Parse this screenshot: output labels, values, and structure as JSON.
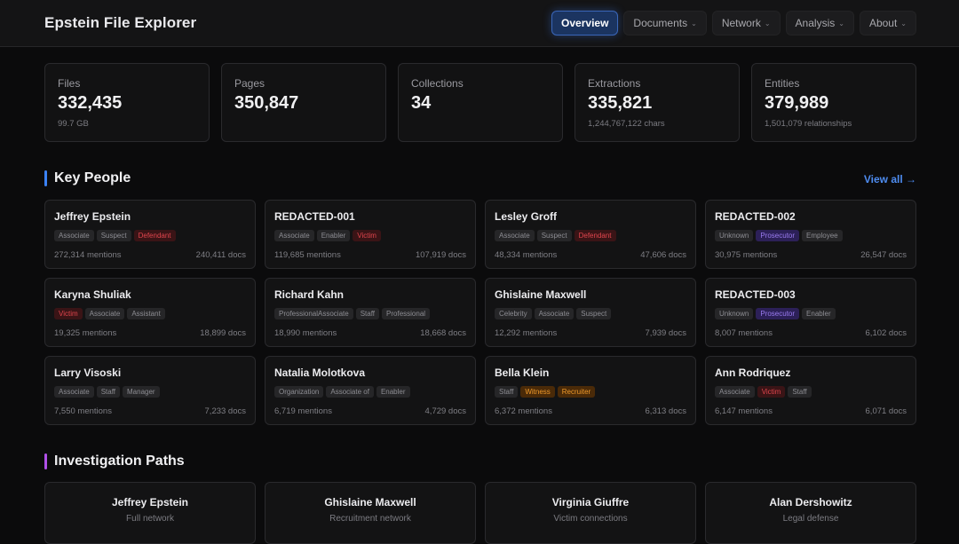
{
  "app": {
    "title": "Epstein File Explorer"
  },
  "nav": [
    {
      "label": "Overview",
      "active": true,
      "dropdown": false
    },
    {
      "label": "Documents",
      "active": false,
      "dropdown": true
    },
    {
      "label": "Network",
      "active": false,
      "dropdown": true
    },
    {
      "label": "Analysis",
      "active": false,
      "dropdown": true
    },
    {
      "label": "About",
      "active": false,
      "dropdown": true
    }
  ],
  "stats": [
    {
      "label": "Files",
      "value": "332,435",
      "sub": "99.7 GB"
    },
    {
      "label": "Pages",
      "value": "350,847",
      "sub": ""
    },
    {
      "label": "Collections",
      "value": "34",
      "sub": ""
    },
    {
      "label": "Extractions",
      "value": "335,821",
      "sub": "1,244,767,122 chars"
    },
    {
      "label": "Entities",
      "value": "379,989",
      "sub": "1,501,079 relationships"
    }
  ],
  "key_people": {
    "title": "Key People",
    "accent": "#3b82f6",
    "view_all": "View all →",
    "people": [
      {
        "name": "Jeffrey Epstein",
        "tags": [
          {
            "text": "Associate",
            "tone": "gray"
          },
          {
            "text": "Suspect",
            "tone": "gray"
          },
          {
            "text": "Defendant",
            "tone": "red"
          }
        ],
        "mentions": "272,314 mentions",
        "docs": "240,411 docs"
      },
      {
        "name": "REDACTED-001",
        "tags": [
          {
            "text": "Associate",
            "tone": "gray"
          },
          {
            "text": "Enabler",
            "tone": "gray"
          },
          {
            "text": "Victim",
            "tone": "red"
          }
        ],
        "mentions": "119,685 mentions",
        "docs": "107,919 docs"
      },
      {
        "name": "Lesley Groff",
        "tags": [
          {
            "text": "Associate",
            "tone": "gray"
          },
          {
            "text": "Suspect",
            "tone": "gray"
          },
          {
            "text": "Defendant",
            "tone": "red"
          }
        ],
        "mentions": "48,334 mentions",
        "docs": "47,606 docs"
      },
      {
        "name": "REDACTED-002",
        "tags": [
          {
            "text": "Unknown",
            "tone": "gray"
          },
          {
            "text": "Prosecutor",
            "tone": "purple"
          },
          {
            "text": "Employee",
            "tone": "gray"
          }
        ],
        "mentions": "30,975 mentions",
        "docs": "26,547 docs"
      },
      {
        "name": "Karyna Shuliak",
        "tags": [
          {
            "text": "Victim",
            "tone": "red"
          },
          {
            "text": "Associate",
            "tone": "gray"
          },
          {
            "text": "Assistant",
            "tone": "gray"
          }
        ],
        "mentions": "19,325 mentions",
        "docs": "18,899 docs"
      },
      {
        "name": "Richard Kahn",
        "tags": [
          {
            "text": "ProfessionalAssociate",
            "tone": "gray"
          },
          {
            "text": "Staff",
            "tone": "gray"
          },
          {
            "text": "Professional",
            "tone": "gray"
          }
        ],
        "mentions": "18,990 mentions",
        "docs": "18,668 docs"
      },
      {
        "name": "Ghislaine Maxwell",
        "tags": [
          {
            "text": "Celebrity",
            "tone": "gray"
          },
          {
            "text": "Associate",
            "tone": "gray"
          },
          {
            "text": "Suspect",
            "tone": "gray"
          }
        ],
        "mentions": "12,292 mentions",
        "docs": "7,939 docs"
      },
      {
        "name": "REDACTED-003",
        "tags": [
          {
            "text": "Unknown",
            "tone": "gray"
          },
          {
            "text": "Prosecutor",
            "tone": "purple"
          },
          {
            "text": "Enabler",
            "tone": "gray"
          }
        ],
        "mentions": "8,007 mentions",
        "docs": "6,102 docs"
      },
      {
        "name": "Larry Visoski",
        "tags": [
          {
            "text": "Associate",
            "tone": "gray"
          },
          {
            "text": "Staff",
            "tone": "gray"
          },
          {
            "text": "Manager",
            "tone": "gray"
          }
        ],
        "mentions": "7,550 mentions",
        "docs": "7,233 docs"
      },
      {
        "name": "Natalia Molotkova",
        "tags": [
          {
            "text": "Organization",
            "tone": "gray"
          },
          {
            "text": "Associate of",
            "tone": "gray"
          },
          {
            "text": "Enabler",
            "tone": "gray"
          }
        ],
        "mentions": "6,719 mentions",
        "docs": "4,729 docs"
      },
      {
        "name": "Bella Klein",
        "tags": [
          {
            "text": "Staff",
            "tone": "gray"
          },
          {
            "text": "Witness",
            "tone": "orange"
          },
          {
            "text": "Recruiter",
            "tone": "orange"
          }
        ],
        "mentions": "6,372 mentions",
        "docs": "6,313 docs"
      },
      {
        "name": "Ann Rodriquez",
        "tags": [
          {
            "text": "Associate",
            "tone": "gray"
          },
          {
            "text": "Victim",
            "tone": "red"
          },
          {
            "text": "Staff",
            "tone": "gray"
          }
        ],
        "mentions": "6,147 mentions",
        "docs": "6,071 docs"
      }
    ]
  },
  "investigation_paths": {
    "title": "Investigation Paths",
    "accent": "#b050e8",
    "paths": [
      {
        "title": "Jeffrey Epstein",
        "subtitle": "Full network"
      },
      {
        "title": "Ghislaine Maxwell",
        "subtitle": "Recruitment network"
      },
      {
        "title": "Virginia Giuffre",
        "subtitle": "Victim connections"
      },
      {
        "title": "Alan Dershowitz",
        "subtitle": "Legal defense"
      }
    ]
  }
}
